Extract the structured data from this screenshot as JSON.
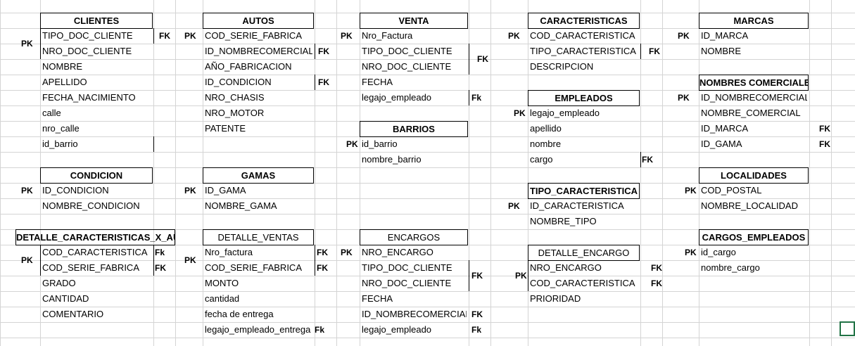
{
  "sheet": {
    "tables": [
      {
        "id": "clientes",
        "title": "CLIENTES",
        "bold": true,
        "fields": [
          "TIPO_DOC_CLIENTE",
          "NRO_DOC_CLIENTE",
          "NOMBRE",
          "APELLIDO",
          "FECHA_NACIMIENTO",
          "calle",
          "nro_calle",
          "id_barrio"
        ]
      },
      {
        "id": "autos",
        "title": "AUTOS",
        "bold": true,
        "fields": [
          "COD_SERIE_FABRICA",
          "ID_NOMBRECOMERCIAL",
          "AÑO_FABRICACION",
          "ID_CONDICION",
          "NRO_CHASIS",
          "NRO_MOTOR",
          "PATENTE"
        ]
      },
      {
        "id": "venta",
        "title": "VENTA",
        "bold": true,
        "fields": [
          "Nro_Factura",
          "TIPO_DOC_CLIENTE",
          "NRO_DOC_CLIENTE",
          "FECHA",
          "legajo_empleado"
        ]
      },
      {
        "id": "caracteristicas",
        "title": "CARACTERISTICAS",
        "bold": true,
        "fields": [
          "COD_CARACTERISTICA",
          "TIPO_CARACTERISTICA",
          "DESCRIPCION"
        ]
      },
      {
        "id": "marcas",
        "title": "MARCAS",
        "bold": true,
        "fields": [
          "ID_MARCA",
          "NOMBRE"
        ]
      },
      {
        "id": "nombres_comerciales",
        "title": "NOMBRES COMERCIALES",
        "bold": true,
        "fields": [
          "ID_NOMBRECOMERCIAL",
          "NOMBRE_COMERCIAL",
          "ID_MARCA",
          "ID_GAMA"
        ]
      },
      {
        "id": "empleados",
        "title": "EMPLEADOS",
        "bold": true,
        "fields": [
          "legajo_empleado",
          "apellido",
          "nombre",
          "cargo"
        ]
      },
      {
        "id": "barrios",
        "title": "BARRIOS",
        "bold": true,
        "fields": [
          "id_barrio",
          "nombre_barrio"
        ]
      },
      {
        "id": "condicion",
        "title": "CONDICION",
        "bold": true,
        "fields": [
          "ID_CONDICION",
          "NOMBRE_CONDICION"
        ]
      },
      {
        "id": "gamas",
        "title": "GAMAS",
        "bold": true,
        "fields": [
          "ID_GAMA",
          "NOMBRE_GAMA"
        ]
      },
      {
        "id": "tipo_caracteristica",
        "title": "TIPO_CARACTERISTICA",
        "bold": true,
        "fields": [
          "ID_CARACTERISTICA",
          "NOMBRE_TIPO"
        ]
      },
      {
        "id": "localidades",
        "title": "LOCALIDADES",
        "bold": true,
        "fields": [
          "COD_POSTAL",
          "NOMBRE_LOCALIDAD"
        ]
      },
      {
        "id": "detalle_caracteristicas_x_auto",
        "title": "DETALLE_CARACTERISTICAS_X_AUTO",
        "bold": true,
        "fields": [
          "COD_CARACTERISTICA",
          "COD_SERIE_FABRICA",
          "GRADO",
          "CANTIDAD",
          "COMENTARIO"
        ]
      },
      {
        "id": "detalle_ventas",
        "title": "DETALLE_VENTAS",
        "bold": false,
        "fields": [
          "Nro_factura",
          "COD_SERIE_FABRICA",
          "MONTO",
          "cantidad",
          "fecha de entrega",
          "legajo_empleado_entrega"
        ]
      },
      {
        "id": "encargos",
        "title": "ENCARGOS",
        "bold": false,
        "fields": [
          "NRO_ENCARGO",
          "TIPO_DOC_CLIENTE",
          "NRO_DOC_CLIENTE",
          "FECHA",
          "ID_NOMBRECOMERCIAL",
          "legajo_empleado"
        ]
      },
      {
        "id": "detalle_encargo",
        "title": "DETALLE_ENCARGO",
        "bold": false,
        "fields": [
          "NRO_ENCARGO",
          "COD_CARACTERISTICA",
          "PRIORIDAD"
        ]
      },
      {
        "id": "cargos_empleados",
        "title": "CARGOS_EMPLEADOS",
        "bold": true,
        "fields": [
          "id_cargo",
          "nombre_cargo"
        ]
      }
    ],
    "key_labels": {
      "pk": "PK",
      "fk_upper": "FK",
      "fk_mixed": "Fk"
    }
  }
}
